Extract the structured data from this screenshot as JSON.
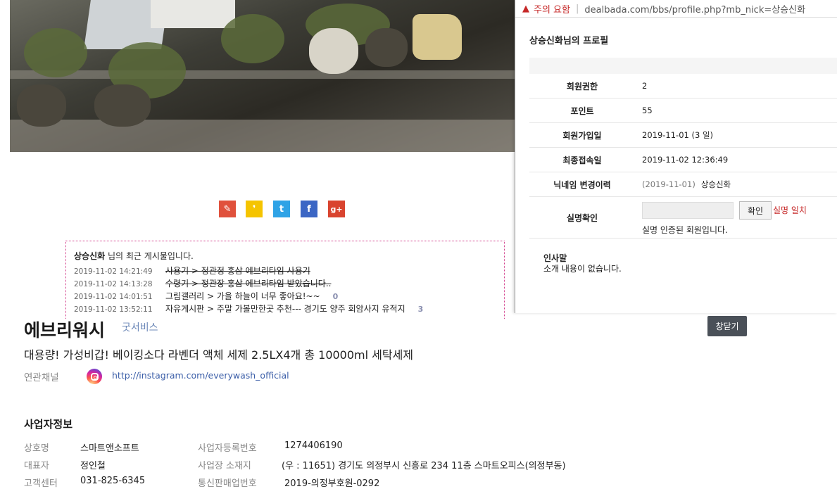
{
  "popup": {
    "warn_text": "주의 요함",
    "url": "dealbada.com/bbs/profile.php?mb_nick=상승신화",
    "title": "상승신화님의 프로필",
    "rows": [
      {
        "key": "회원권한",
        "value": "2"
      },
      {
        "key": "포인트",
        "value": "55"
      },
      {
        "key": "회원가입일",
        "value": "2019-11-01 (3 일)"
      },
      {
        "key": "최종접속일",
        "value": "2019-11-02 12:36:49"
      },
      {
        "key": "닉네임 변경이력",
        "value_gray": "(2019-11-01)",
        "value": "상승신화"
      }
    ],
    "realname": {
      "key": "실명확인",
      "button": "확인",
      "match": "실명 일치",
      "note": "실명 인증된 회원입니다."
    },
    "greeting": {
      "label": "인사말",
      "text": "소개 내용이 없습니다."
    }
  },
  "recent": {
    "nick": "상승신화",
    "title_suffix": " 님의 최근 게시물입니다.",
    "posts": [
      {
        "date": "2019-11-02 14:21:49",
        "title": "사용기 > 정관정 홍삼 에브리타임 사용기",
        "strike": true,
        "count": ""
      },
      {
        "date": "2019-11-02 14:13:28",
        "title": "수령기 > 정관장 홍삼 에브리타임 받았습니다..",
        "strike": true,
        "count": ""
      },
      {
        "date": "2019-11-02 14:01:51",
        "title": "그림갤러리 > 가을 하늘이 너무 좋아요!~~",
        "strike": false,
        "count": "0"
      },
      {
        "date": "2019-11-02 13:52:11",
        "title": "자유게시판 > 주말 가볼만한곳 추천--- 경기도 양주 회암사지 유적지",
        "strike": false,
        "count": "3"
      }
    ]
  },
  "share": [
    {
      "name": "share-link-icon",
      "glyph": "✎",
      "color": "#e0513c"
    },
    {
      "name": "share-kakao-icon",
      "glyph": "❜",
      "color": "#f5c400"
    },
    {
      "name": "share-twitter-icon",
      "glyph": "t",
      "color": "#2fa3e6"
    },
    {
      "name": "share-facebook-icon",
      "glyph": "f",
      "color": "#3b66c4"
    },
    {
      "name": "share-googleplus-icon",
      "glyph": "g+",
      "color": "#d9442f"
    }
  ],
  "shop": {
    "name": "에브리워시",
    "tag": "굿서비스",
    "close_button": "창닫기",
    "description": "대용량! 가성비갑! 베이킹소다 라벤더 액체 세제 2.5LX4개 총 10000ml 세탁세제",
    "channel_label": "연관채널",
    "channel_link": "http://instagram.com/everywash_official"
  },
  "business": {
    "title": "사업자정보",
    "rows": [
      {
        "k1": "상호명",
        "v1": "스마트앤소프트",
        "k2": "사업자등록번호",
        "v2": "1274406190"
      },
      {
        "k1": "대표자",
        "v1": "정인철",
        "k2": "사업장 소재지",
        "v2": "(우 : 11651) 경기도 의정부시 신흥로 234 11층 스마트오피스(의정부동)"
      },
      {
        "k1": "고객센터",
        "v1": "031-825-6345",
        "k2": "통신판매업번호",
        "v2": "2019-의정부호원-0292"
      }
    ]
  }
}
